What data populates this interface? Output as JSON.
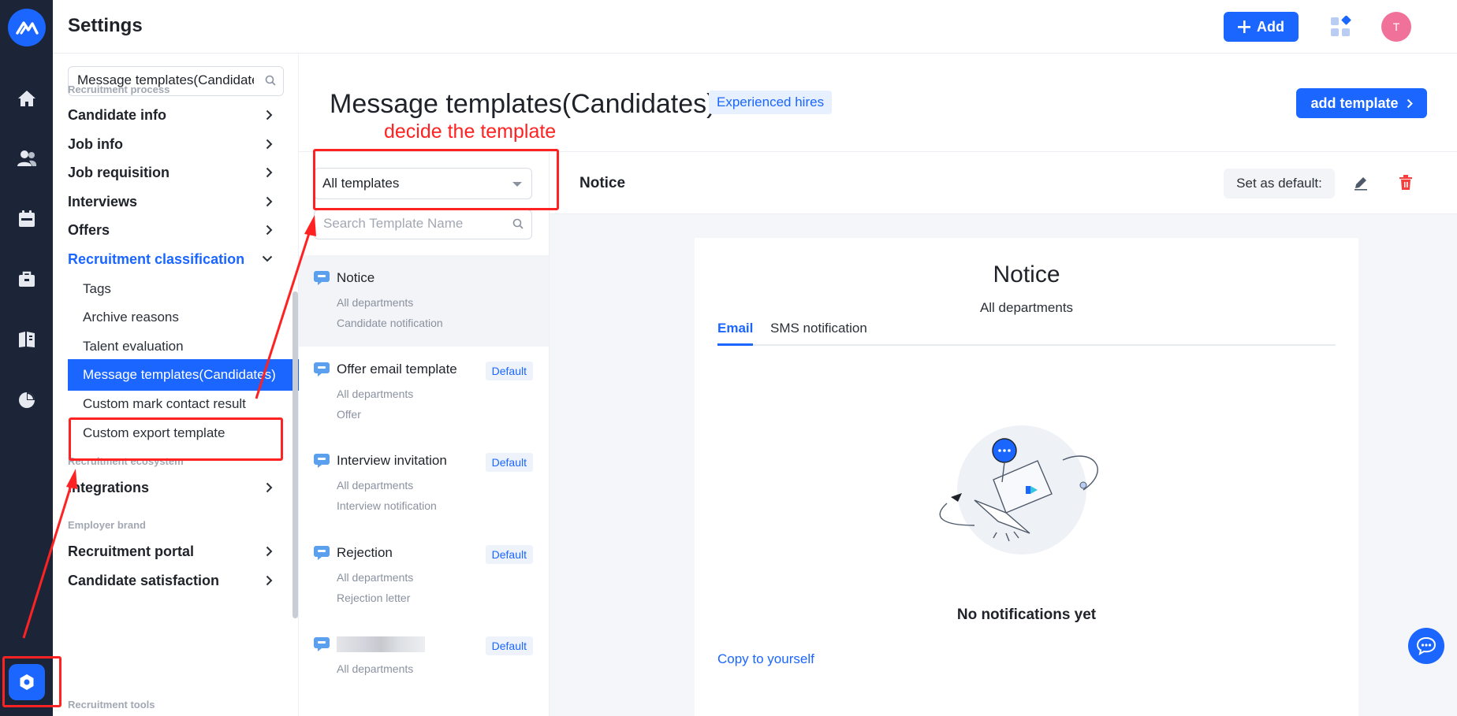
{
  "header": {
    "title": "Settings",
    "add_label": "Add",
    "avatar_initial": "T"
  },
  "sidebar": {
    "search_value": "Message templates(Candidate",
    "sections": {
      "recruitment_process": "Recruitment process",
      "recruitment_ecosystem": "Recruitment ecosystem",
      "employer_brand": "Employer brand",
      "recruitment_tools": "Recruitment tools"
    },
    "items": [
      {
        "label": "Candidate info"
      },
      {
        "label": "Job info"
      },
      {
        "label": "Job requisition"
      },
      {
        "label": "Interviews"
      },
      {
        "label": "Offers"
      },
      {
        "label": "Recruitment classification"
      }
    ],
    "sub_items": [
      {
        "label": "Tags"
      },
      {
        "label": "Archive reasons"
      },
      {
        "label": "Talent evaluation"
      },
      {
        "label": "Message templates(Candidates)"
      },
      {
        "label": "Custom mark contact result"
      },
      {
        "label": "Custom export template"
      }
    ],
    "ecosystem_items": [
      {
        "label": "Integrations"
      }
    ],
    "brand_items": [
      {
        "label": "Recruitment portal"
      },
      {
        "label": "Candidate satisfaction"
      }
    ]
  },
  "main": {
    "page_title": "Message templates(Candidates)",
    "badge": "Experienced hires",
    "add_template_label": "add template",
    "filter_value": "All templates",
    "search_placeholder": "Search Template Name",
    "templates": [
      {
        "name": "Notice",
        "line1": "All departments",
        "line2": "Candidate notification",
        "default": ""
      },
      {
        "name": "Offer email template",
        "line1": "All departments",
        "line2": "Offer",
        "default": "Default"
      },
      {
        "name": "Interview invitation",
        "line1": "All departments",
        "line2": "Interview notification",
        "default": "Default"
      },
      {
        "name": "Rejection",
        "line1": "All departments",
        "line2": "Rejection letter",
        "default": "Default"
      },
      {
        "name": "",
        "line1": "All departments",
        "line2": "",
        "default": "Default"
      }
    ]
  },
  "detail": {
    "title": "Notice",
    "set_default_label": "Set as default:",
    "card_title": "Notice",
    "card_subtitle": "All departments",
    "tabs": [
      {
        "label": "Email"
      },
      {
        "label": "SMS notification"
      }
    ],
    "empty_text": "No notifications yet",
    "copy_link": "Copy to yourself"
  },
  "annotation": {
    "text": "decide the template",
    "color": "#ff2222"
  },
  "colors": {
    "accent": "#1a66ff",
    "rail": "#1c2538",
    "danger": "#f53f3f",
    "avatar": "#f0729a"
  },
  "icons": [
    "logo-icon",
    "home-icon",
    "people-icon",
    "calendar-icon",
    "briefcase-icon",
    "book-icon",
    "pie-chart-icon",
    "settings-icon",
    "search-icon",
    "chevron-right-icon",
    "chevron-down-icon",
    "message-icon",
    "edit-icon",
    "trash-icon",
    "plus-icon",
    "apps-icon",
    "chat-icon"
  ]
}
